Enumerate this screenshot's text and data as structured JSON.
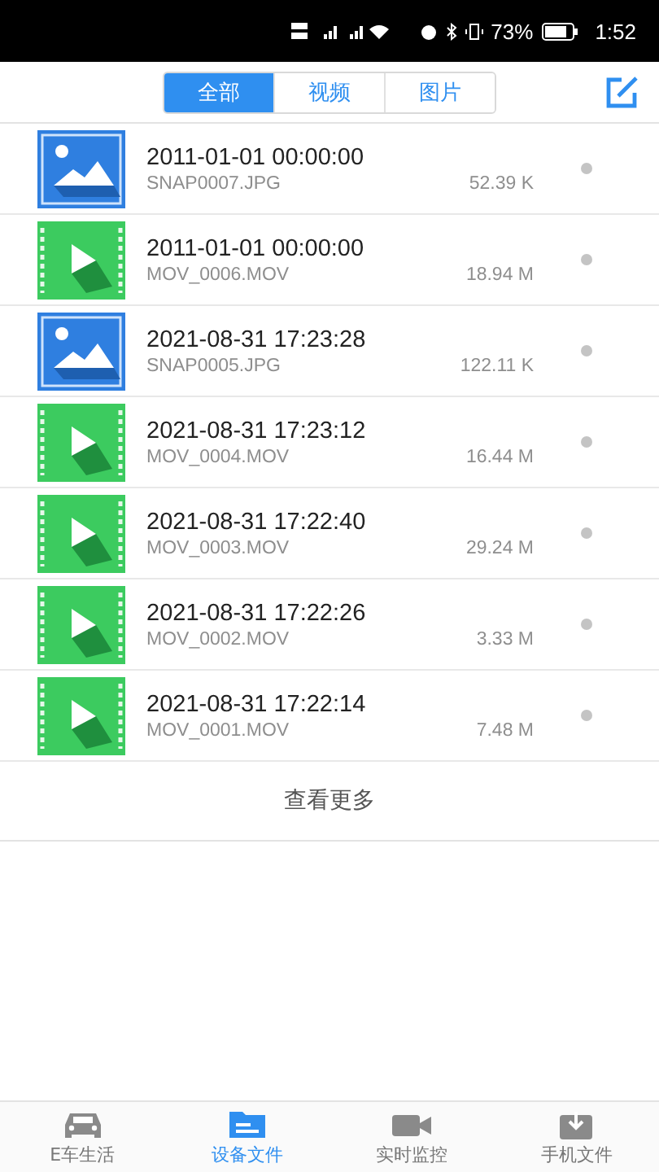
{
  "status_bar": {
    "battery": "73%",
    "time": "1:52"
  },
  "tabs": [
    {
      "label": "全部",
      "selected": true
    },
    {
      "label": "视频",
      "selected": false
    },
    {
      "label": "图片",
      "selected": false
    }
  ],
  "files": [
    {
      "kind": "image",
      "date": "2011-01-01 00:00:00",
      "name": "SNAP0007.JPG",
      "size": "52.39 K"
    },
    {
      "kind": "video",
      "date": "2011-01-01 00:00:00",
      "name": "MOV_0006.MOV",
      "size": "18.94 M"
    },
    {
      "kind": "image",
      "date": "2021-08-31 17:23:28",
      "name": "SNAP0005.JPG",
      "size": "122.11 K"
    },
    {
      "kind": "video",
      "date": "2021-08-31 17:23:12",
      "name": "MOV_0004.MOV",
      "size": "16.44 M"
    },
    {
      "kind": "video",
      "date": "2021-08-31 17:22:40",
      "name": "MOV_0003.MOV",
      "size": "29.24 M"
    },
    {
      "kind": "video",
      "date": "2021-08-31 17:22:26",
      "name": "MOV_0002.MOV",
      "size": "3.33 M"
    },
    {
      "kind": "video",
      "date": "2021-08-31 17:22:14",
      "name": "MOV_0001.MOV",
      "size": "7.48 M"
    }
  ],
  "more": "查看更多",
  "nav": [
    {
      "kind": "car",
      "label": "E车生活",
      "selected": false
    },
    {
      "kind": "folder",
      "label": "设备文件",
      "selected": true
    },
    {
      "kind": "camera",
      "label": "实时监控",
      "selected": false
    },
    {
      "kind": "phone",
      "label": "手机文件",
      "selected": false
    }
  ]
}
